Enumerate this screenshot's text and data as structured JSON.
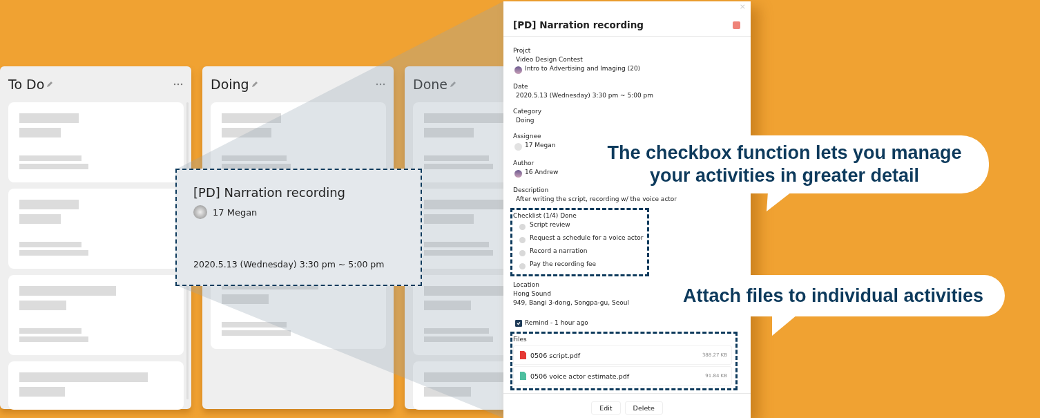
{
  "board": {
    "columns": [
      {
        "title": "To Do",
        "menu": true
      },
      {
        "title": "Doing",
        "menu": true
      },
      {
        "title": "Done",
        "menu": false
      }
    ]
  },
  "highlight_card": {
    "title": "[PD] Narration recording",
    "assignee": "17 Megan",
    "date": "2020.5.13 (Wednesday) 3:30 pm ~ 5:00 pm"
  },
  "detail": {
    "close": "×",
    "title": "[PD] Narration recording",
    "color": "#ef8379",
    "fields": [
      {
        "kind": "project",
        "label": "Projct",
        "value": "Video Design Contest",
        "course": "Intro to Advertising and Imaging (20)"
      },
      {
        "kind": "text",
        "label": "Date",
        "value": "2020.5.13 (Wednesday) 3:30 pm ~ 5:00 pm"
      },
      {
        "kind": "text",
        "label": "Category",
        "value": "Doing"
      },
      {
        "kind": "person",
        "label": "Assignee",
        "value": "17 Megan"
      },
      {
        "kind": "person",
        "label": "Author",
        "value": "16 Andrew"
      },
      {
        "kind": "text",
        "label": "Description",
        "value": "After writing the script, recording w/ the voice actor"
      }
    ],
    "checklist": {
      "title": "Checklist (1/4) Done",
      "items": [
        {
          "label": "Script review",
          "checked": false
        },
        {
          "label": "Request a schedule for a voice actor",
          "checked": false
        },
        {
          "label": "Record a narration",
          "checked": false
        },
        {
          "label": "Pay the recording fee",
          "checked": false
        }
      ]
    },
    "location": {
      "label": "Location",
      "lines": [
        "Hong Sound",
        "949, Bangi 3-dong, Songpa-gu, Seoul"
      ]
    },
    "remind": {
      "label": "Remind - 1 hour ago",
      "checked": true
    },
    "files": {
      "label": "Files",
      "items": [
        {
          "name": "0506 script.pdf",
          "size": "388.27 KB",
          "color": "#e53935"
        },
        {
          "name": "0506 voice actor estimate.pdf",
          "size": "91.84 KB",
          "color": "#4dbf9f"
        }
      ]
    },
    "buttons": [
      "Edit",
      "Delete"
    ]
  },
  "callouts": [
    {
      "text": "The checkbox function lets you manage\nyour activities in greater detail"
    },
    {
      "text": "Attach files to individual activities"
    }
  ]
}
